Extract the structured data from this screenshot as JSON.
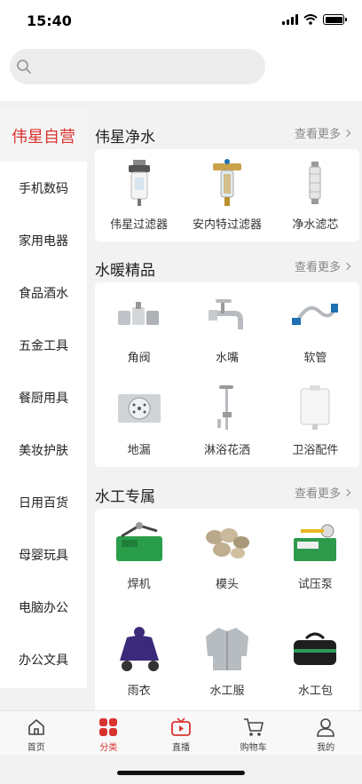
{
  "status": {
    "time": "15:40"
  },
  "search": {
    "placeholder": ""
  },
  "sidebar": {
    "items": [
      {
        "label": "伟星自营",
        "active": true
      },
      {
        "label": "手机数码"
      },
      {
        "label": "家用电器"
      },
      {
        "label": "食品酒水"
      },
      {
        "label": "五金工具"
      },
      {
        "label": "餐厨用具"
      },
      {
        "label": "美妆护肤"
      },
      {
        "label": "日用百货"
      },
      {
        "label": "母婴玩具"
      },
      {
        "label": "电脑办公"
      },
      {
        "label": "办公文具"
      }
    ]
  },
  "sections": [
    {
      "title": "伟星净水",
      "more": "查看更多",
      "items": [
        {
          "label": "伟星过滤器",
          "icon": "water-filter-icon"
        },
        {
          "label": "安内特过滤器",
          "icon": "brass-filter-icon"
        },
        {
          "label": "净水滤芯",
          "icon": "filter-cartridge-icon"
        }
      ]
    },
    {
      "title": "水暖精品",
      "more": "查看更多",
      "items": [
        {
          "label": "角阀",
          "icon": "angle-valve-icon"
        },
        {
          "label": "水嘴",
          "icon": "faucet-icon"
        },
        {
          "label": "软管",
          "icon": "hose-icon"
        },
        {
          "label": "地漏",
          "icon": "floor-drain-icon"
        },
        {
          "label": "淋浴花洒",
          "icon": "shower-icon"
        },
        {
          "label": "卫浴配件",
          "icon": "cistern-icon"
        }
      ]
    },
    {
      "title": "水工专属",
      "more": "查看更多",
      "items": [
        {
          "label": "焊机",
          "icon": "welder-icon"
        },
        {
          "label": "模头",
          "icon": "die-head-icon"
        },
        {
          "label": "试压泵",
          "icon": "pressure-pump-icon"
        },
        {
          "label": "雨衣",
          "icon": "raincoat-icon"
        },
        {
          "label": "水工服",
          "icon": "work-jacket-icon"
        },
        {
          "label": "水工包",
          "icon": "tool-bag-icon"
        }
      ]
    }
  ],
  "tabbar": {
    "items": [
      {
        "label": "首页",
        "icon": "home-icon"
      },
      {
        "label": "分类",
        "icon": "category-icon",
        "active": true
      },
      {
        "label": "直播",
        "icon": "live-tv-icon"
      },
      {
        "label": "购物车",
        "icon": "cart-icon"
      },
      {
        "label": "我的",
        "icon": "profile-icon"
      }
    ]
  },
  "colors": {
    "accent": "#d9332f",
    "background": "#f2f2f2"
  }
}
